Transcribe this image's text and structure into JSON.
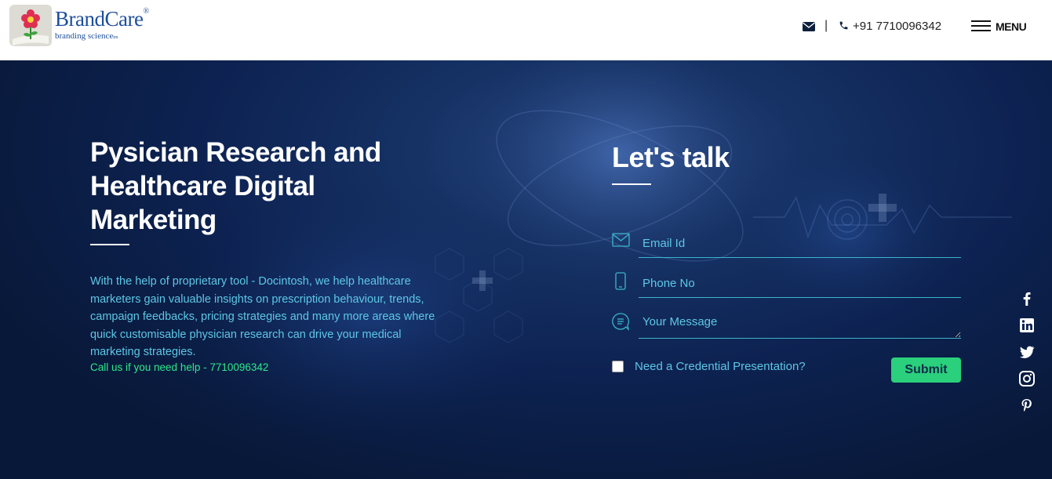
{
  "brand": {
    "name": "BrandCare",
    "mark": "®",
    "tagline": "branding science",
    "tagline_mark": "tm"
  },
  "header": {
    "mail_icon": "envelope-icon",
    "separator": "|",
    "phone_icon": "phone-icon",
    "phone": "+91 7710096342",
    "menu_label": "MENU"
  },
  "hero": {
    "title": "Pysician Research and Healthcare Digital Marketing",
    "description": "With the help of proprietary tool - Docintosh, we help healthcare marketers gain valuable insights on prescription behaviour, trends, campaign feedbacks, pricing strategies and many more areas where quick customisable physician research can drive your medical marketing strategies.",
    "call_text": "Call us if you need help - 7710096342"
  },
  "form": {
    "title": "Let's talk",
    "email_placeholder": "Email Id",
    "phone_placeholder": "Phone No",
    "message_placeholder": "Your Message",
    "checkbox_label": "Need a Credential Presentation?",
    "checkbox_checked": false,
    "submit_label": "Submit"
  },
  "social": [
    "facebook-icon",
    "linkedin-icon",
    "twitter-icon",
    "instagram-icon",
    "pinterest-icon"
  ],
  "colors": {
    "accent_green": "#2ad07c",
    "text_cyan": "#5ec7e6",
    "hero_bg": "#0d2251",
    "call_green": "#2ee88a"
  }
}
